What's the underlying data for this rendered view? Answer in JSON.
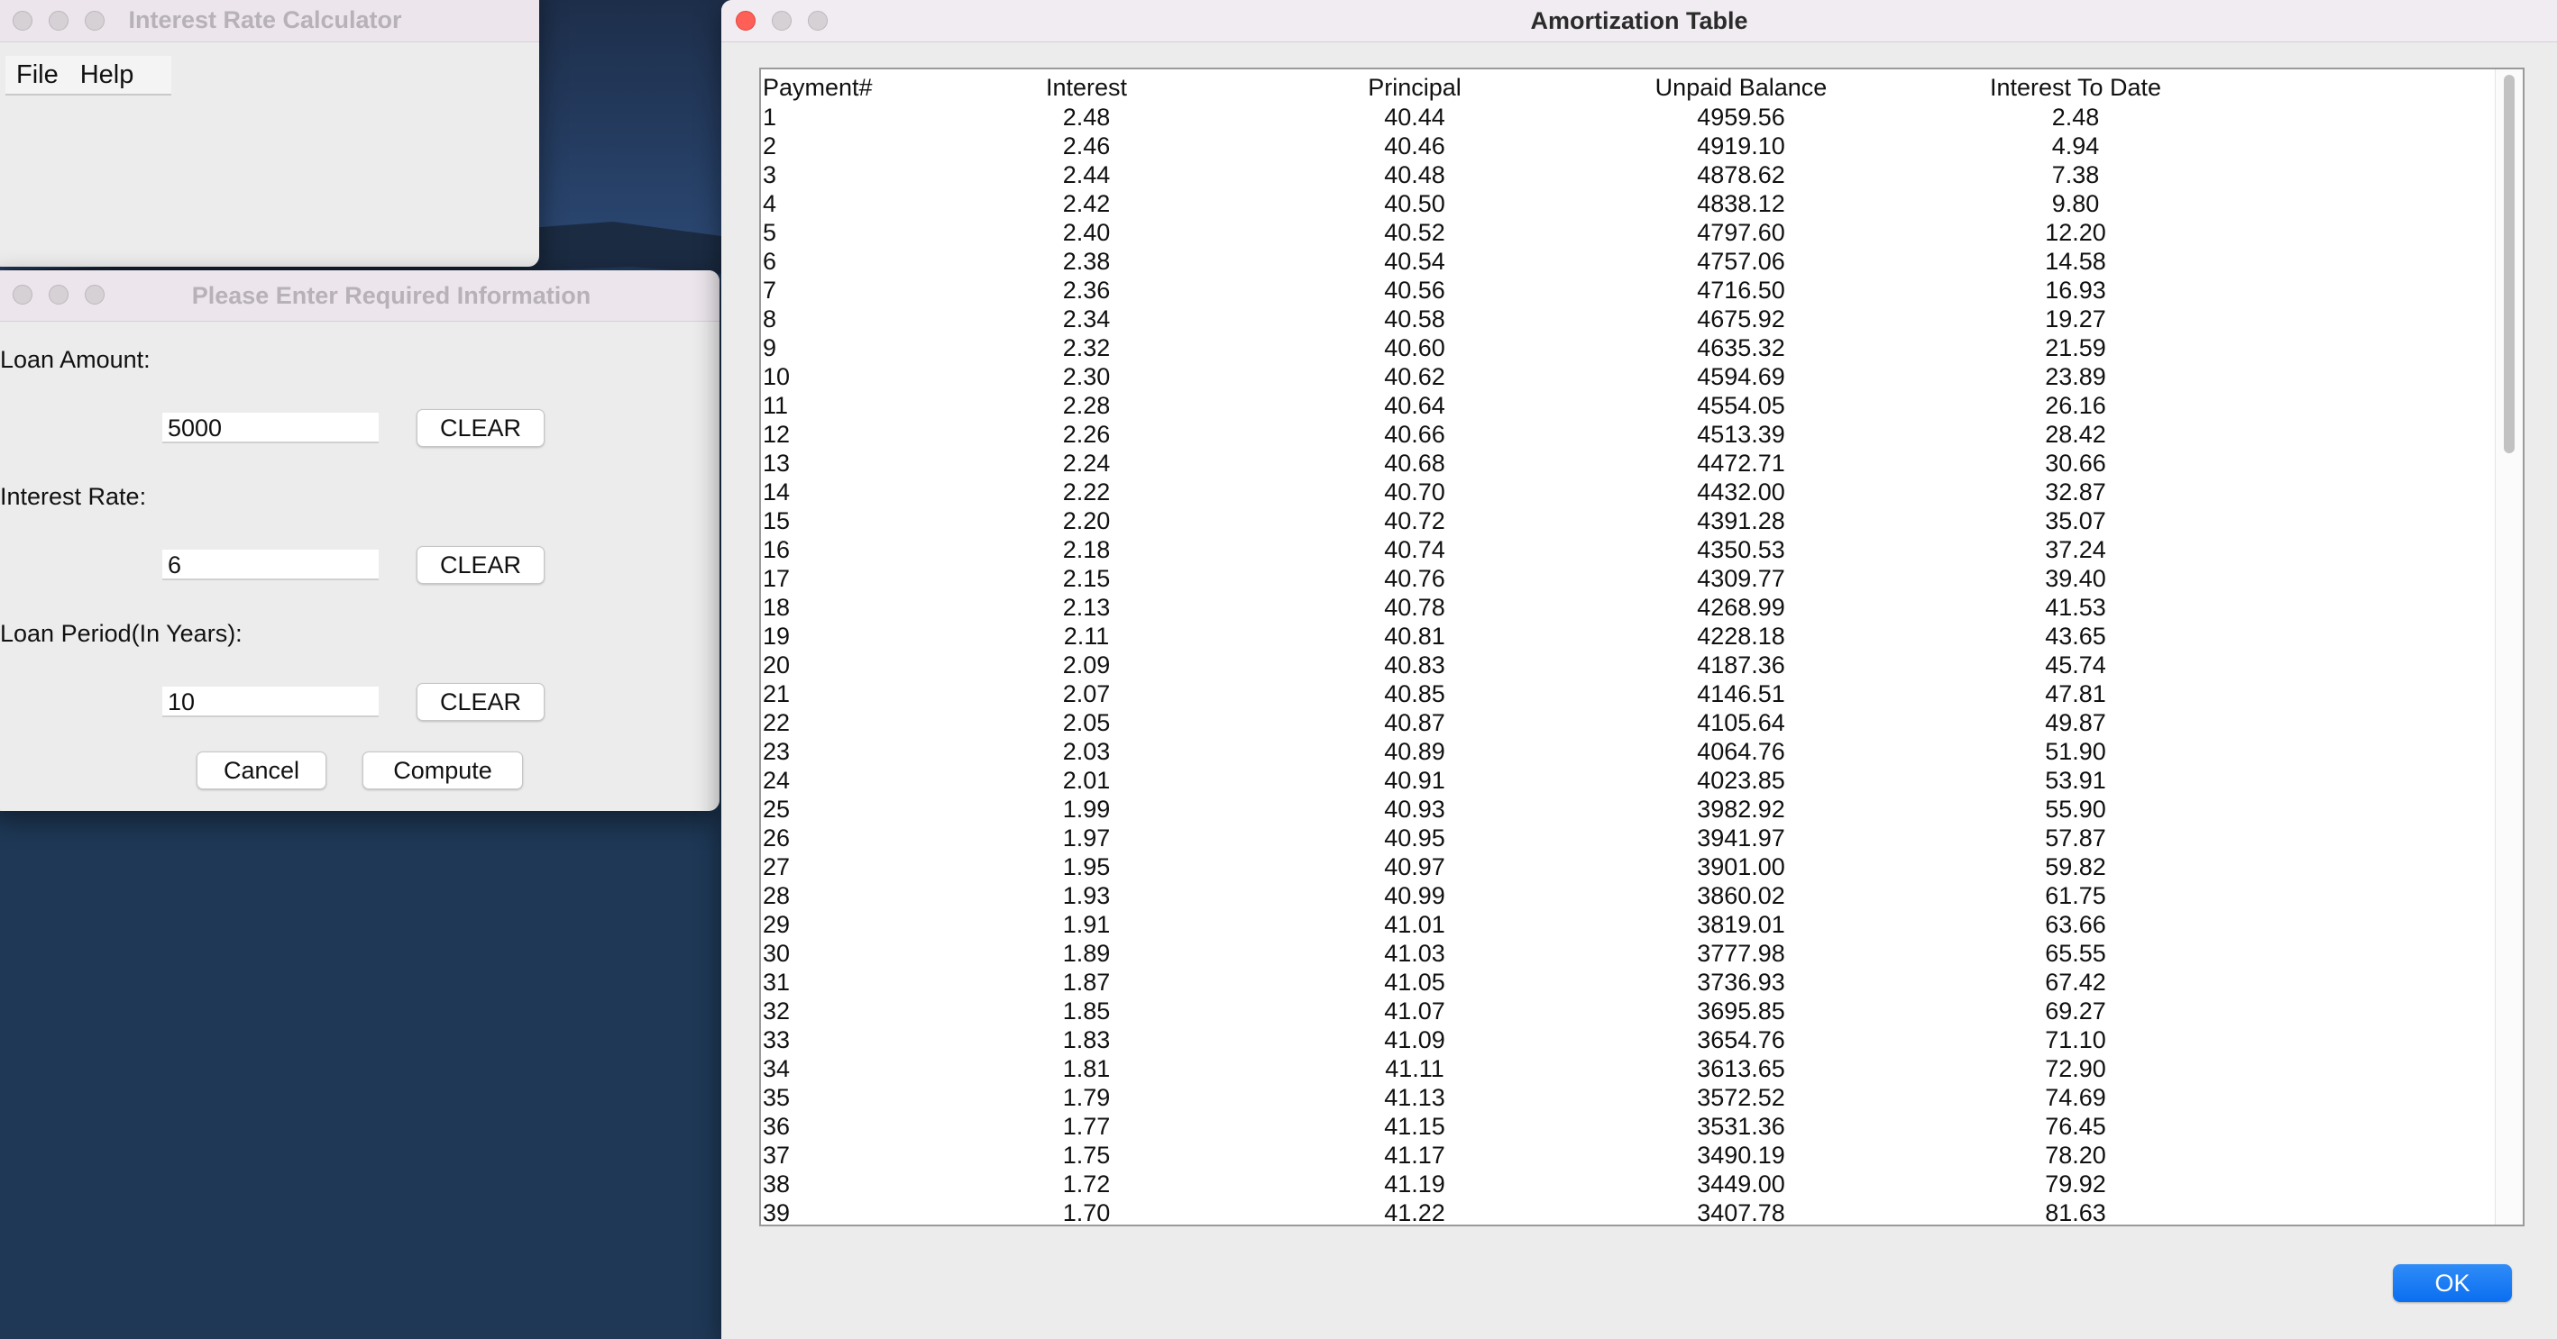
{
  "calculator_window": {
    "title": "Interest Rate Calculator",
    "menu": [
      "File",
      "Help"
    ]
  },
  "input_dialog": {
    "title": "Please Enter Required Information",
    "fields": [
      {
        "label": "Loan Amount:",
        "value": "5000",
        "clear_label": "CLEAR"
      },
      {
        "label": "Interest Rate:",
        "value": "6",
        "clear_label": "CLEAR"
      },
      {
        "label": "Loan Period(In Years):",
        "value": "10",
        "clear_label": "CLEAR"
      }
    ],
    "cancel_label": "Cancel",
    "compute_label": "Compute"
  },
  "table_window": {
    "title": "Amortization Table",
    "ok_label": "OK",
    "columns": [
      "Payment#",
      "Interest",
      "Principal",
      "Unpaid Balance",
      "Interest To Date"
    ],
    "rows": [
      [
        "1",
        "2.48",
        "40.44",
        "4959.56",
        "2.48"
      ],
      [
        "2",
        "2.46",
        "40.46",
        "4919.10",
        "4.94"
      ],
      [
        "3",
        "2.44",
        "40.48",
        "4878.62",
        "7.38"
      ],
      [
        "4",
        "2.42",
        "40.50",
        "4838.12",
        "9.80"
      ],
      [
        "5",
        "2.40",
        "40.52",
        "4797.60",
        "12.20"
      ],
      [
        "6",
        "2.38",
        "40.54",
        "4757.06",
        "14.58"
      ],
      [
        "7",
        "2.36",
        "40.56",
        "4716.50",
        "16.93"
      ],
      [
        "8",
        "2.34",
        "40.58",
        "4675.92",
        "19.27"
      ],
      [
        "9",
        "2.32",
        "40.60",
        "4635.32",
        "21.59"
      ],
      [
        "10",
        "2.30",
        "40.62",
        "4594.69",
        "23.89"
      ],
      [
        "11",
        "2.28",
        "40.64",
        "4554.05",
        "26.16"
      ],
      [
        "12",
        "2.26",
        "40.66",
        "4513.39",
        "28.42"
      ],
      [
        "13",
        "2.24",
        "40.68",
        "4472.71",
        "30.66"
      ],
      [
        "14",
        "2.22",
        "40.70",
        "4432.00",
        "32.87"
      ],
      [
        "15",
        "2.20",
        "40.72",
        "4391.28",
        "35.07"
      ],
      [
        "16",
        "2.18",
        "40.74",
        "4350.53",
        "37.24"
      ],
      [
        "17",
        "2.15",
        "40.76",
        "4309.77",
        "39.40"
      ],
      [
        "18",
        "2.13",
        "40.78",
        "4268.99",
        "41.53"
      ],
      [
        "19",
        "2.11",
        "40.81",
        "4228.18",
        "43.65"
      ],
      [
        "20",
        "2.09",
        "40.83",
        "4187.36",
        "45.74"
      ],
      [
        "21",
        "2.07",
        "40.85",
        "4146.51",
        "47.81"
      ],
      [
        "22",
        "2.05",
        "40.87",
        "4105.64",
        "49.87"
      ],
      [
        "23",
        "2.03",
        "40.89",
        "4064.76",
        "51.90"
      ],
      [
        "24",
        "2.01",
        "40.91",
        "4023.85",
        "53.91"
      ],
      [
        "25",
        "1.99",
        "40.93",
        "3982.92",
        "55.90"
      ],
      [
        "26",
        "1.97",
        "40.95",
        "3941.97",
        "57.87"
      ],
      [
        "27",
        "1.95",
        "40.97",
        "3901.00",
        "59.82"
      ],
      [
        "28",
        "1.93",
        "40.99",
        "3860.02",
        "61.75"
      ],
      [
        "29",
        "1.91",
        "41.01",
        "3819.01",
        "63.66"
      ],
      [
        "30",
        "1.89",
        "41.03",
        "3777.98",
        "65.55"
      ],
      [
        "31",
        "1.87",
        "41.05",
        "3736.93",
        "67.42"
      ],
      [
        "32",
        "1.85",
        "41.07",
        "3695.85",
        "69.27"
      ],
      [
        "33",
        "1.83",
        "41.09",
        "3654.76",
        "71.10"
      ],
      [
        "34",
        "1.81",
        "41.11",
        "3613.65",
        "72.90"
      ],
      [
        "35",
        "1.79",
        "41.13",
        "3572.52",
        "74.69"
      ],
      [
        "36",
        "1.77",
        "41.15",
        "3531.36",
        "76.45"
      ],
      [
        "37",
        "1.75",
        "41.17",
        "3490.19",
        "78.20"
      ],
      [
        "38",
        "1.72",
        "41.19",
        "3449.00",
        "79.92"
      ],
      [
        "39",
        "1.70",
        "41.22",
        "3407.78",
        "81.63"
      ]
    ]
  }
}
